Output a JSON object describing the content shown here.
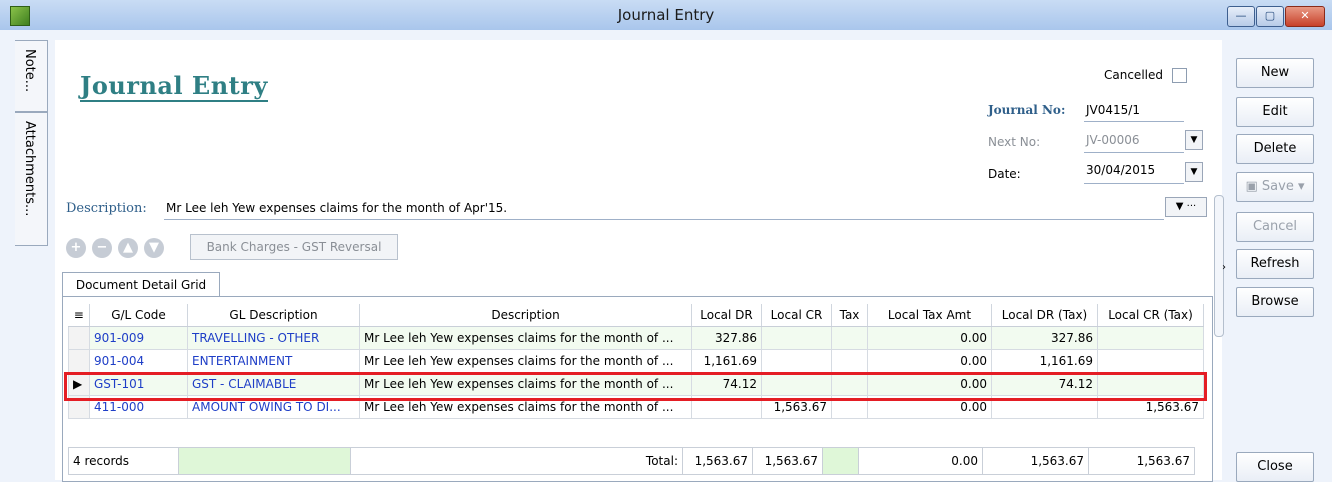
{
  "window": {
    "title": "Journal Entry",
    "controls": {
      "minimize": "—",
      "maximize": "▢",
      "close": "✕"
    }
  },
  "side_tabs": [
    {
      "label": "Note..."
    },
    {
      "label": "Attachments..."
    }
  ],
  "form": {
    "heading": "Journal Entry",
    "cancelled_label": "Cancelled",
    "journal_no_label": "Journal No:",
    "journal_no": "JV0415/1",
    "next_no_label": "Next No:",
    "next_no": "JV-00006",
    "date_label": "Date:",
    "date": "30/04/2015",
    "description_label": "Description:",
    "description": "Mr Lee leh Yew expenses claims for the month of Apr'15.",
    "bank_charges_button": "Bank Charges - GST Reversal",
    "tab_label": "Document Detail Grid"
  },
  "grid": {
    "headers": [
      "G/L Code",
      "GL Description",
      "Description",
      "Local DR",
      "Local CR",
      "Tax",
      "Local Tax Amt",
      "Local DR (Tax)",
      "Local CR (Tax)"
    ],
    "rows": [
      {
        "code": "901-009",
        "gl_desc": "TRAVELLING - OTHER",
        "desc": "Mr Lee leh Yew expenses claims for the month of ...",
        "dr": "327.86",
        "cr": "",
        "tax": "",
        "tax_amt": "0.00",
        "dr_tax": "327.86",
        "cr_tax": ""
      },
      {
        "code": "901-004",
        "gl_desc": "ENTERTAINMENT",
        "desc": "Mr Lee leh Yew expenses claims for the month of ...",
        "dr": "1,161.69",
        "cr": "",
        "tax": "",
        "tax_amt": "0.00",
        "dr_tax": "1,161.69",
        "cr_tax": ""
      },
      {
        "code": "GST-101",
        "gl_desc": "GST - CLAIMABLE",
        "desc": "Mr Lee leh Yew expenses claims for the month of ...",
        "dr": "74.12",
        "cr": "",
        "tax": "",
        "tax_amt": "0.00",
        "dr_tax": "74.12",
        "cr_tax": ""
      },
      {
        "code": "411-000",
        "gl_desc": "AMOUNT OWING TO DI...",
        "desc": "Mr Lee leh Yew expenses claims for the month of ...",
        "dr": "",
        "cr": "1,563.67",
        "tax": "",
        "tax_amt": "0.00",
        "dr_tax": "",
        "cr_tax": "1,563.67"
      }
    ],
    "footer": {
      "records": "4 records",
      "total_label": "Total:",
      "dr": "1,563.67",
      "cr": "1,563.67",
      "tax_amt": "0.00",
      "dr_tax": "1,563.67",
      "cr_tax": "1,563.67"
    }
  },
  "buttons": {
    "new": "New",
    "edit": "Edit",
    "delete": "Delete",
    "save": "Save",
    "cancel": "Cancel",
    "refresh": "Refresh",
    "browse": "Browse",
    "close": "Close"
  },
  "colors": {
    "heading": "#2f7f84",
    "link": "#1e3ec7",
    "highlight_box": "#e41d24",
    "row_tint": "#f2fbf0"
  }
}
